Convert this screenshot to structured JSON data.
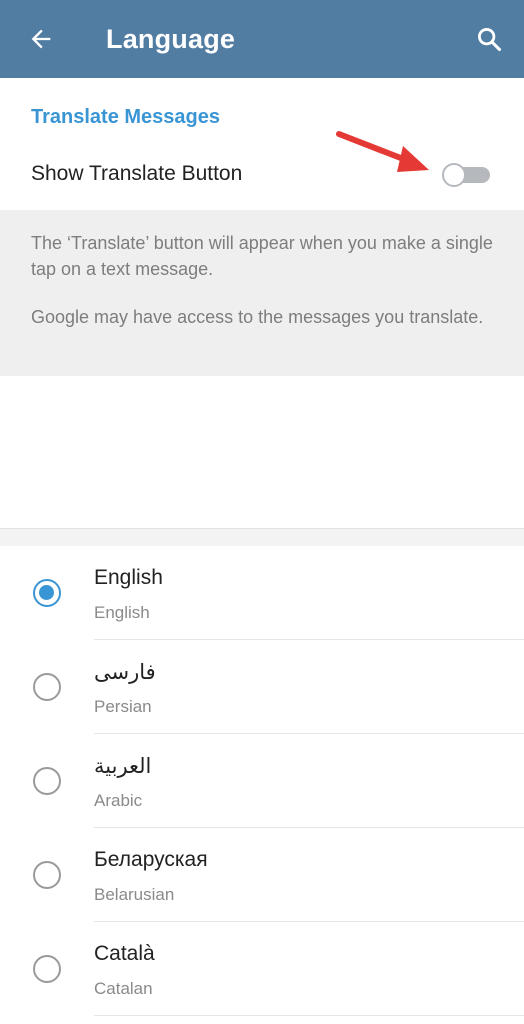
{
  "appbar": {
    "title": "Language",
    "back_icon": "arrow-left-icon",
    "search_icon": "search-icon",
    "color": "#527da3"
  },
  "translate": {
    "section_title": "Translate Messages",
    "toggle_label": "Show Translate Button",
    "toggle_on": false,
    "info_1": "The ‘Translate’ button will appear when you make a single tap on a text message.",
    "info_2": "Google may have access to the messages you translate.",
    "annotation": "red-arrow-icon"
  },
  "languages": [
    {
      "name": "English",
      "sub": "English",
      "selected": true
    },
    {
      "name": "فارسی",
      "sub": "Persian",
      "selected": false
    },
    {
      "name": "العربية",
      "sub": "Arabic",
      "selected": false
    },
    {
      "name": "Беларуская",
      "sub": "Belarusian",
      "selected": false
    },
    {
      "name": "Català",
      "sub": "Catalan",
      "selected": false
    }
  ],
  "colors": {
    "accent": "#3a95d5",
    "header": "#527da3",
    "arrow": "#e53935"
  }
}
